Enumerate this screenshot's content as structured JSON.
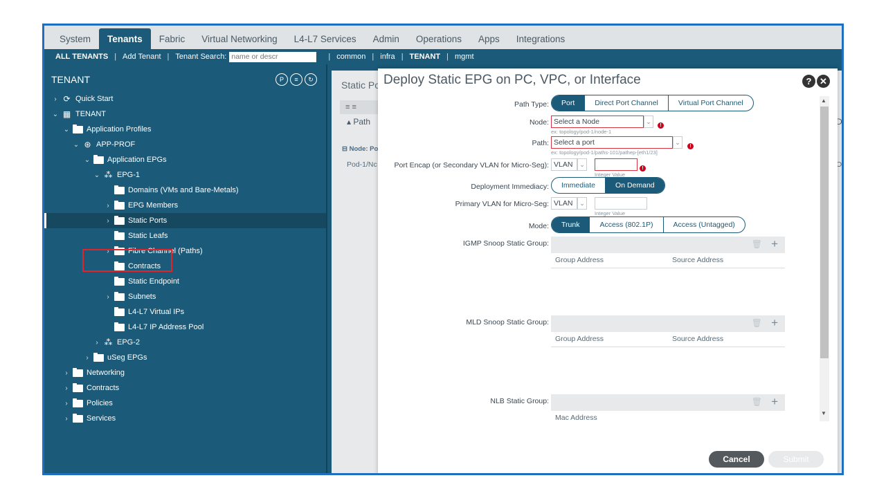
{
  "topnav": {
    "items": [
      "System",
      "Tenants",
      "Fabric",
      "Virtual Networking",
      "L4-L7 Services",
      "Admin",
      "Operations",
      "Apps",
      "Integrations"
    ],
    "active_index": 1
  },
  "subnav": {
    "all_tenants": "ALL TENANTS",
    "add_tenant": "Add Tenant",
    "tenant_search_label": "Tenant Search:",
    "tenant_search_placeholder": "name or descr",
    "common": "common",
    "infra": "infra",
    "tenant": "TENANT",
    "mgmt": "mgmt"
  },
  "sidebar": {
    "title": "TENANT",
    "tree": [
      {
        "label": "Quick Start",
        "icon": "quick-start-icon",
        "chev": "›"
      },
      {
        "label": "TENANT",
        "icon": "tenant-icon",
        "chev": "⌄"
      },
      {
        "label": "Application Profiles",
        "icon": "folder-icon",
        "chev": "⌄"
      },
      {
        "label": "APP-PROF",
        "icon": "app-profile-icon",
        "chev": "⌄"
      },
      {
        "label": "Application EPGs",
        "icon": "folder-icon",
        "chev": "⌄"
      },
      {
        "label": "EPG-1",
        "icon": "epg-icon",
        "chev": "⌄"
      },
      {
        "label": "Domains (VMs and Bare-Metals)",
        "icon": "folder-icon",
        "chev": ""
      },
      {
        "label": "EPG Members",
        "icon": "folder-icon",
        "chev": "›"
      },
      {
        "label": "Static Ports",
        "icon": "folder-icon",
        "chev": "›"
      },
      {
        "label": "Static Leafs",
        "icon": "folder-icon",
        "chev": ""
      },
      {
        "label": "Fibre Channel (Paths)",
        "icon": "folder-icon",
        "chev": "›"
      },
      {
        "label": "Contracts",
        "icon": "folder-icon",
        "chev": ""
      },
      {
        "label": "Static Endpoint",
        "icon": "folder-icon",
        "chev": ""
      },
      {
        "label": "Subnets",
        "icon": "folder-icon",
        "chev": "›"
      },
      {
        "label": "L4-L7 Virtual IPs",
        "icon": "folder-icon",
        "chev": ""
      },
      {
        "label": "L4-L7 IP Address Pool",
        "icon": "folder-icon",
        "chev": ""
      },
      {
        "label": "EPG-2",
        "icon": "epg-icon",
        "chev": "›"
      },
      {
        "label": "uSeg EPGs",
        "icon": "folder-icon",
        "chev": "›"
      },
      {
        "label": "Networking",
        "icon": "folder-icon",
        "chev": "›"
      },
      {
        "label": "Contracts",
        "icon": "folder-icon",
        "chev": "›"
      },
      {
        "label": "Policies",
        "icon": "folder-icon",
        "chev": "›"
      },
      {
        "label": "Services",
        "icon": "folder-icon",
        "chev": "›"
      }
    ]
  },
  "background": {
    "title": "Static Po",
    "path": "Path",
    "node": "Node: Po",
    "pod": "Pod-1/Nc",
    "right_d": "D",
    "right_o": "O"
  },
  "dialog": {
    "title": "Deploy Static EPG on PC, VPC, or Interface",
    "path_type_label": "Path Type:",
    "path_type_options": [
      "Port",
      "Direct Port Channel",
      "Virtual Port Channel"
    ],
    "node_label": "Node:",
    "node_placeholder": "Select a Node",
    "node_hint": "ex: topology/pod-1/node-1",
    "path_label": "Path:",
    "path_placeholder": "Select a port",
    "path_hint": "ex: topology/pod-1/paths-101/pathep-[eth1/23]",
    "port_encap_label": "Port Encap (or Secondary VLAN for Micro-Seg):",
    "port_encap_type": "VLAN",
    "port_encap_hint": "Integer Value",
    "deployment_label": "Deployment Immediacy:",
    "deployment_options": [
      "Immediate",
      "On Demand"
    ],
    "primary_vlan_label": "Primary VLAN for Micro-Seg:",
    "primary_vlan_type": "VLAN",
    "primary_vlan_hint": "Integer Value",
    "mode_label": "Mode:",
    "mode_options": [
      "Trunk",
      "Access (802.1P)",
      "Access (Untagged)"
    ],
    "igmp_label": "IGMP Snoop Static Group:",
    "igmp_cols": [
      "Group Address",
      "Source Address"
    ],
    "mld_label": "MLD Snoop Static Group:",
    "mld_cols": [
      "Group Address",
      "Source Address"
    ],
    "nlb_label": "NLB Static Group:",
    "nlb_cols": [
      "Mac Address"
    ],
    "cancel": "Cancel",
    "submit": "Submit"
  }
}
